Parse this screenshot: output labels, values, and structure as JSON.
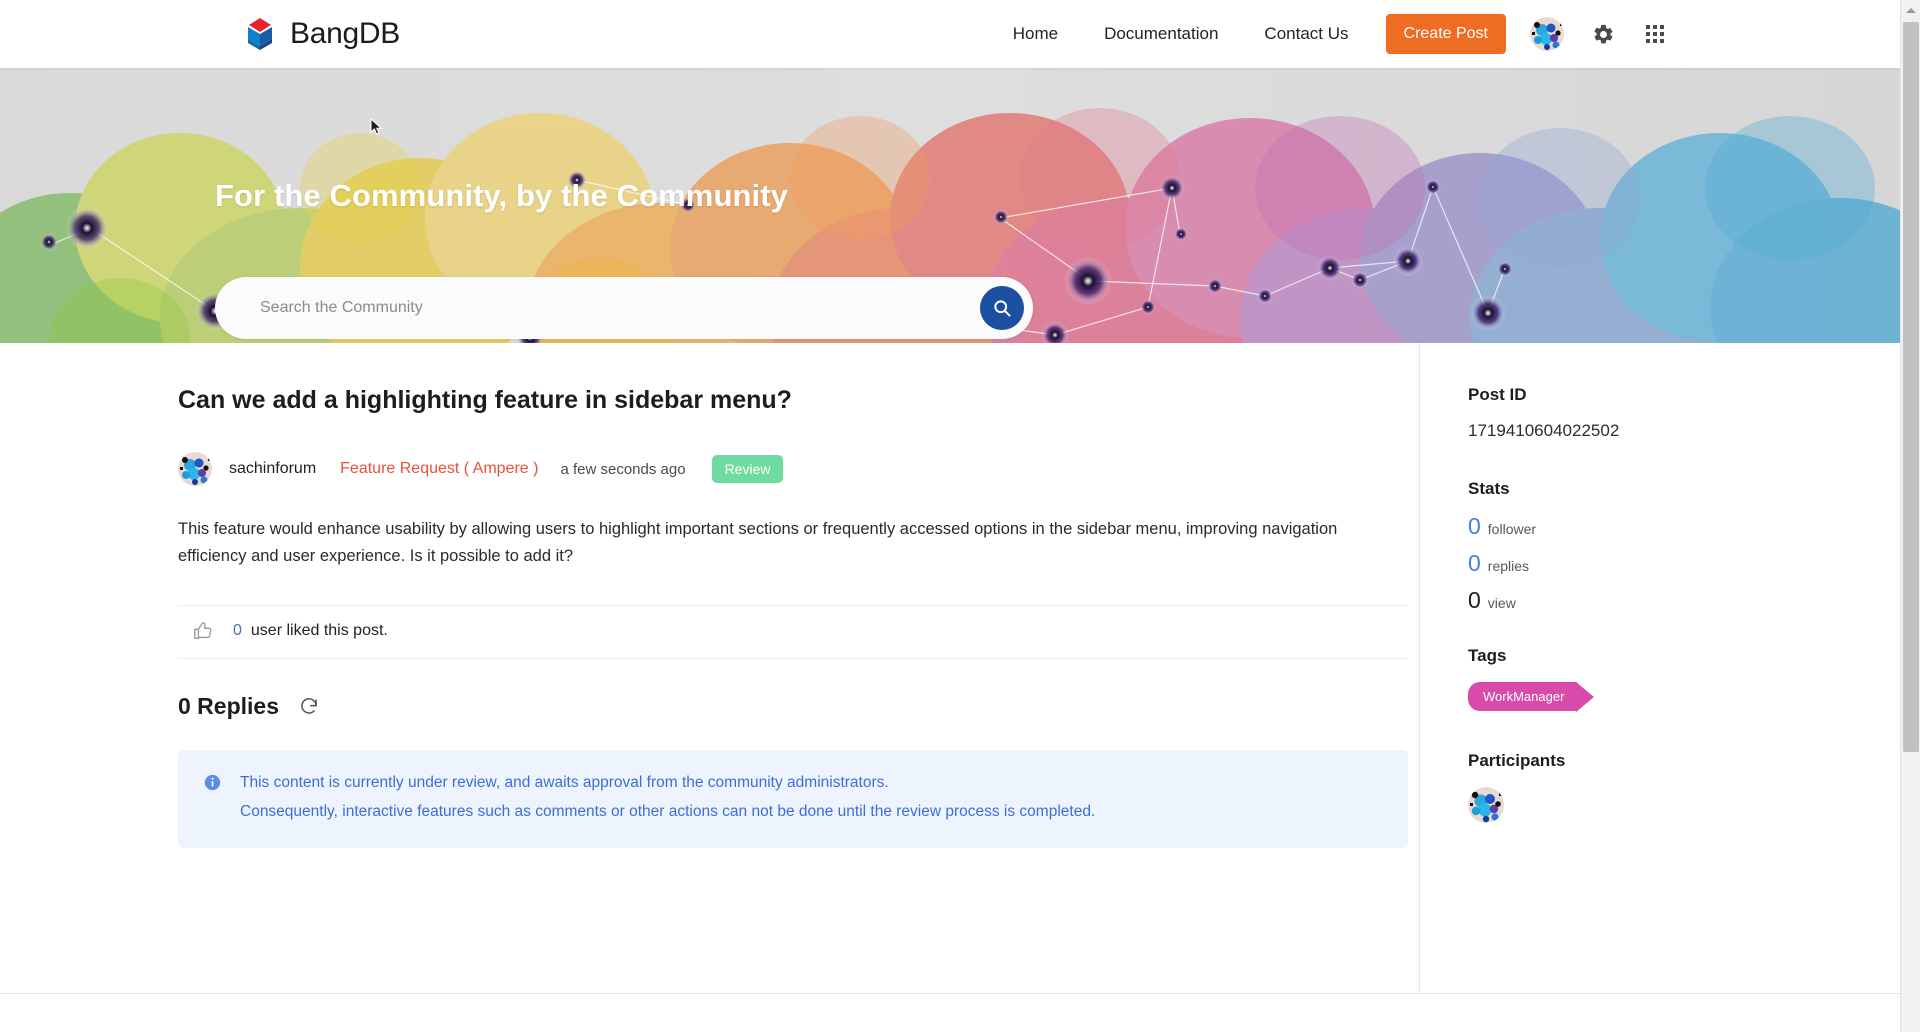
{
  "header": {
    "brand": "BangDB",
    "brand_logo_icon": "bangdb-diamond-logo",
    "nav": [
      {
        "label": "Home",
        "name": "nav-home"
      },
      {
        "label": "Documentation",
        "name": "nav-documentation"
      },
      {
        "label": "Contact Us",
        "name": "nav-contact-us"
      }
    ],
    "create_post_label": "Create Post",
    "create_post_color": "#ee6d22",
    "avatar_icon": "user-avatar",
    "settings_icon": "gear-icon",
    "apps_icon": "grid-apps-icon"
  },
  "hero": {
    "title": "For the Community, by the Community",
    "search_placeholder": "Search the Community",
    "search_value": "",
    "search_icon": "search-icon",
    "search_button_color": "#1b4fa0"
  },
  "post": {
    "title": "Can we add a highlighting feature in sidebar menu?",
    "author": "sachinforum",
    "author_avatar_icon": "user-avatar",
    "category": "Feature Request ( Ampere )",
    "category_color": "#e8503a",
    "time": "a few seconds ago",
    "status": "Review",
    "status_color": "#6fdba0",
    "body": "This feature would enhance usability by allowing users to highlight important sections or frequently accessed options in the sidebar menu, improving navigation efficiency and user experience. Is it possible to add it?",
    "like_icon": "thumbs-up-icon",
    "like_count": "0",
    "like_text": "user liked this post.",
    "replies_heading": "0 Replies",
    "refresh_icon": "refresh-icon"
  },
  "notice": {
    "icon": "info-circle-icon",
    "line1": "This content is currently under review, and awaits approval from the community administrators.",
    "line2": "Consequently, interactive features such as comments or other actions can not be done until the review process is completed.",
    "color": "#3c6ed8",
    "background": "#eef4fe"
  },
  "sidebar": {
    "post_id_heading": "Post ID",
    "post_id_value": "1719410604022502",
    "stats_heading": "Stats",
    "stats": [
      {
        "value": "0",
        "label": "follower",
        "name": "stat-follower"
      },
      {
        "value": "0",
        "label": "replies",
        "name": "stat-replies"
      },
      {
        "value": "0",
        "label": "view",
        "name": "stat-view"
      }
    ],
    "tags_heading": "Tags",
    "tags": [
      {
        "label": "WorkManager",
        "color": "#d84bab"
      }
    ],
    "participants_heading": "Participants",
    "participants": [
      {
        "name": "participant-avatar",
        "icon": "user-avatar"
      }
    ]
  }
}
